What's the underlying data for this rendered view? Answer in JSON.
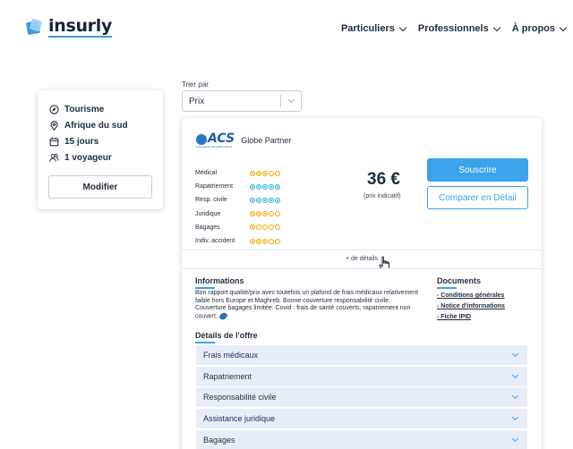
{
  "brand": {
    "name": "insurly"
  },
  "nav": {
    "items": [
      {
        "label": "Particuliers"
      },
      {
        "label": "Professionnels"
      },
      {
        "label": "À propos"
      }
    ]
  },
  "trip": {
    "destination_type": "Tourisme",
    "destination": "Afrique du sud",
    "duration": "15 jours",
    "travellers": "1 voyageur",
    "modify_label": "Modifier"
  },
  "sort": {
    "label": "Trier par",
    "value": "Prix"
  },
  "offer": {
    "partner_logo_text": "ACS",
    "partner_logo_sub": "L'assurance des globe-trotters",
    "partner_name": "Globe Partner",
    "ratings": [
      {
        "label": "Médical",
        "score": 3,
        "max": 5,
        "color": "#f0a800"
      },
      {
        "label": "Rapatriement",
        "score": 5,
        "max": 5,
        "color": "#28b0d8"
      },
      {
        "label": "Resp. civile",
        "score": 5,
        "max": 5,
        "color": "#28b0d8"
      },
      {
        "label": "Juridique",
        "score": 3,
        "max": 5,
        "color": "#f0a800"
      },
      {
        "label": "Bagages",
        "score": 1,
        "max": 5,
        "color": "#f0a800"
      },
      {
        "label": "Indiv. accident",
        "score": 3,
        "max": 5,
        "color": "#f0a800"
      }
    ],
    "price": "36 €",
    "price_note": "(prix indicatif)",
    "subscribe_label": "Souscrire",
    "compare_label": "Comparer en Détail",
    "more_details_label": "+ de détails",
    "informations_title": "Informations",
    "informations_text": "Bon rapport qualité/prix avec toutefois un plafond de frais médicaux relativement faible hors Europe et Maghreb. Bonne couverture responsabilité civile. Couverture bagages limitée. Covid : frais de santé couverts, rapatriement non couvert.",
    "documents_title": "Documents",
    "documents": [
      {
        "label": "- Conditions générales"
      },
      {
        "label": "- Notice d'informations"
      },
      {
        "label": "- Fiche IPID"
      }
    ],
    "offer_details_title": "Détails de l'offre",
    "accordion": [
      {
        "label": "Frais médicaux"
      },
      {
        "label": "Rapatriement"
      },
      {
        "label": "Responsabilité civile"
      },
      {
        "label": "Assistance juridique"
      },
      {
        "label": "Bagages"
      }
    ]
  },
  "colors": {
    "accent": "#3aa3ea",
    "rating_gold": "#f0a800",
    "rating_blue": "#28b0d8",
    "accordion_bg": "#e8eef9"
  }
}
